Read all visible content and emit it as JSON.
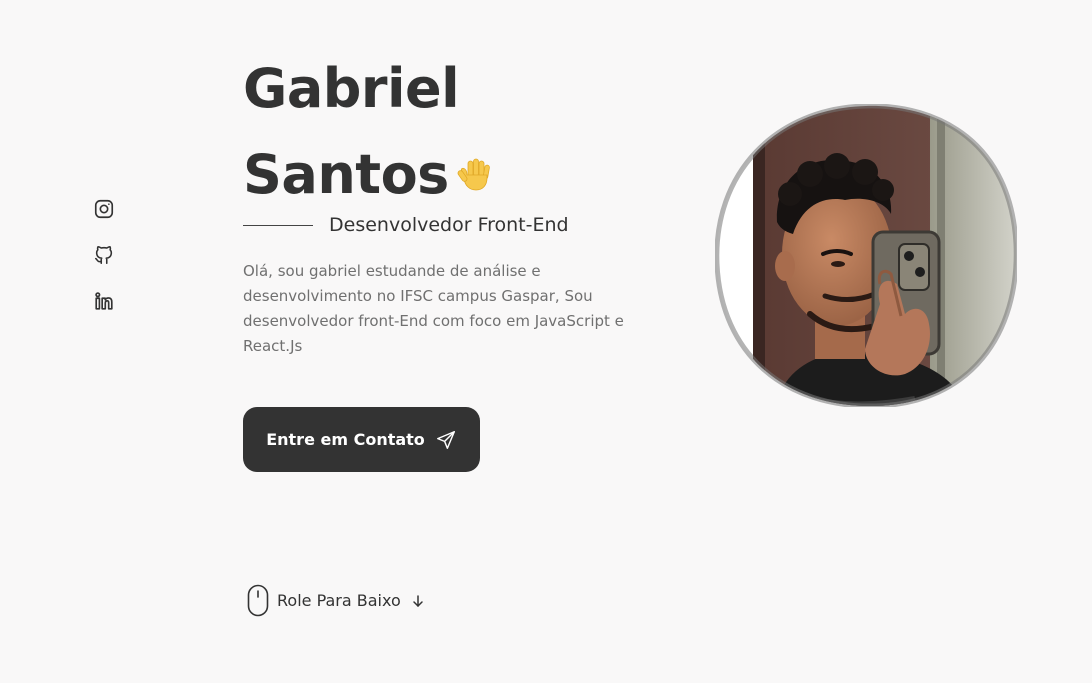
{
  "social": {
    "items": [
      {
        "icon": "instagram-icon"
      },
      {
        "icon": "github-icon"
      },
      {
        "icon": "linkedin-icon"
      }
    ]
  },
  "hero": {
    "title_line1": "Gabriel",
    "title_line2": "Santos",
    "wave_icon": "waving-hand-icon",
    "subtitle": "Desenvolvedor Front-End",
    "description": "Olá, sou gabriel estudande de análise e desenvolvimento no IFSC campus Gaspar, Sou desenvolvedor front-End com foco em JavaScript e React.Js",
    "cta_label": "Entre em Contato",
    "cta_icon": "send-icon"
  },
  "scroll": {
    "label": "Role Para Baixo",
    "mouse_icon": "mouse-icon",
    "arrow_icon": "arrow-down-icon"
  },
  "colors": {
    "background": "#f9f8f8",
    "text": "#333333",
    "muted": "#707070",
    "button": "#333333"
  }
}
